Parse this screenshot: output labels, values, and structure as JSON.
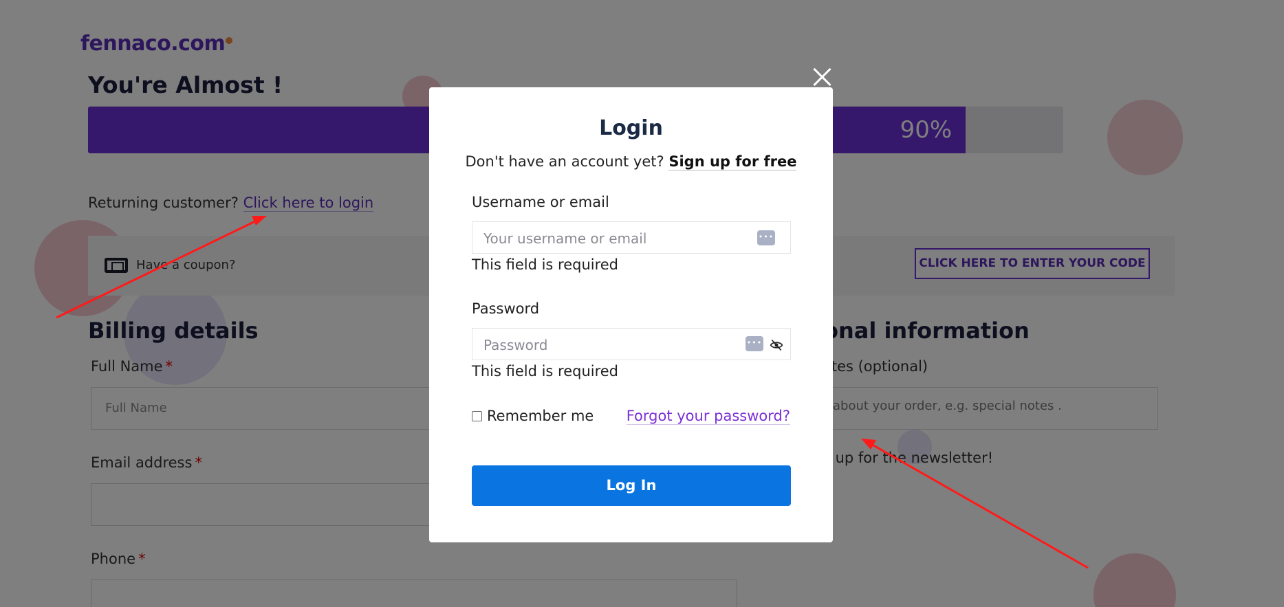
{
  "brand": {
    "logo_text": "fennaco.com"
  },
  "progress": {
    "heading": "You're Almost !",
    "percent_label": "90%",
    "percent": 90
  },
  "returning": {
    "text": "Returning customer?",
    "link": "Click here to login"
  },
  "coupon": {
    "text": "Have a coupon?",
    "button": "CLICK HERE TO ENTER YOUR CODE"
  },
  "billing": {
    "title": "Billing details",
    "full_name_label": "Full Name",
    "full_name_placeholder": "Full Name",
    "email_label": "Email address",
    "phone_label": "Phone",
    "required_mark": "*"
  },
  "additional": {
    "title_visible": "ional information",
    "notes_label_visible": "otes (optional)",
    "notes_placeholder_visible": "about your order, e.g. special notes .",
    "newsletter_visible": "e up for the newsletter!"
  },
  "modal": {
    "title": "Login",
    "signup_prompt": "Don't have an account yet?",
    "signup_link": "Sign up for free",
    "username_label": "Username or email",
    "username_placeholder": "Your username or email",
    "username_error": "This field is required",
    "password_label": "Password",
    "password_placeholder": "Password",
    "password_error": "This field is required",
    "remember_label": "Remember me",
    "forgot_link": "Forgot your password?",
    "login_button": "Log In",
    "key_icon_text": "•••"
  },
  "colors": {
    "brand_purple": "#6b2fd6",
    "login_button_blue": "#0a74e0",
    "annotation_arrow": "#ff1a1a"
  }
}
